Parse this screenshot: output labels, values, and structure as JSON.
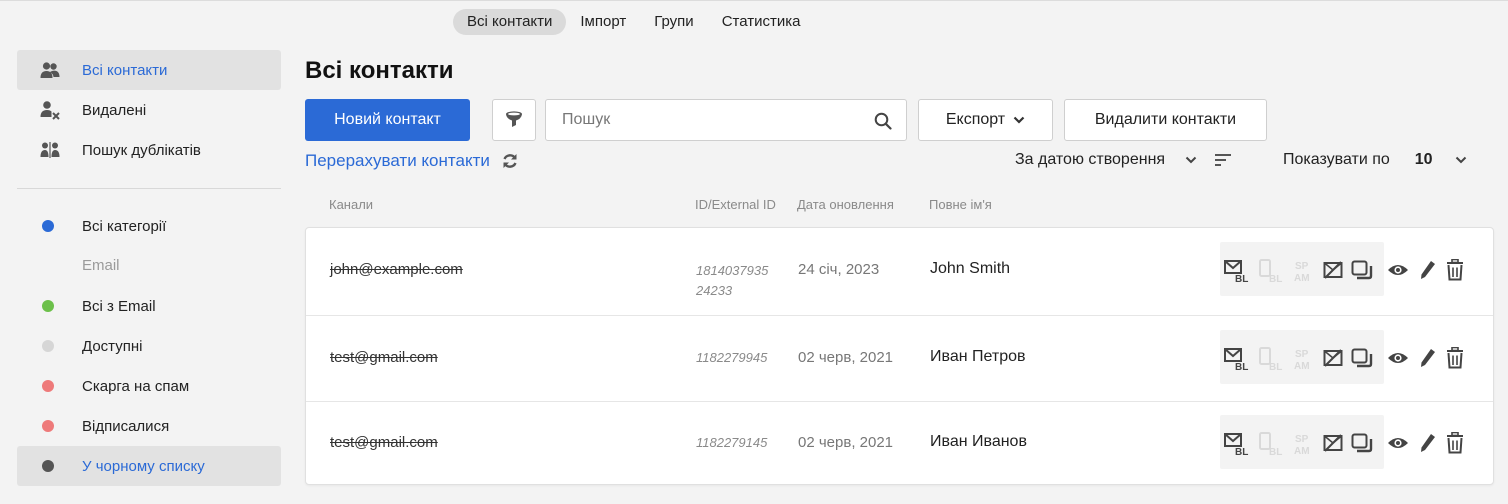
{
  "topnav": {
    "tabs": [
      {
        "label": "Всі контакти",
        "active": true
      },
      {
        "label": "Імпорт",
        "active": false
      },
      {
        "label": "Групи",
        "active": false
      },
      {
        "label": "Статистика",
        "active": false
      }
    ]
  },
  "sidebar": {
    "items": [
      {
        "label": "Всі контакти",
        "icon": "users-icon",
        "active": true
      },
      {
        "label": "Видалені",
        "icon": "user-remove-icon",
        "active": false
      },
      {
        "label": "Пошук дублікатів",
        "icon": "duplicates-icon",
        "active": false
      }
    ],
    "categories": [
      {
        "label": "Всі категорії",
        "color": "#2b6ad6"
      }
    ],
    "email_section": "Email",
    "email_items": [
      {
        "label": "Всі з Email",
        "color": "#6cc04a"
      },
      {
        "label": "Доступні",
        "color": "#d6d6d6"
      },
      {
        "label": "Скарга на спам",
        "color": "#ee7a7a"
      },
      {
        "label": "Відписалися",
        "color": "#ee7a7a"
      },
      {
        "label": "У чорному списку",
        "color": "#555555",
        "active": true
      }
    ]
  },
  "main": {
    "title": "Всі контакти",
    "new_contact_label": "Новий контакт",
    "search_placeholder": "Пошук",
    "export_label": "Експорт",
    "delete_label": "Видалити контакти",
    "recount_label": "Перерахувати контакти",
    "sort_label": "За датою створення",
    "per_page_label": "Показувати по",
    "per_page_value": "10"
  },
  "table": {
    "headers": {
      "channels": "Канали",
      "id": "ID/External ID",
      "date": "Дата оновлення",
      "name": "Повне ім'я"
    },
    "rows": [
      {
        "email": "john@example.com",
        "id_line1": "1814037935",
        "id_line2": "24233",
        "date": "24 січ, 2023",
        "name": "John Smith"
      },
      {
        "email": "test@gmail.com",
        "id_line1": "1182279945",
        "id_line2": "",
        "date": "02 черв, 2021",
        "name": "Иван Петров"
      },
      {
        "email": "test@gmail.com",
        "id_line1": "1182279145",
        "id_line2": "",
        "date": "02 черв, 2021",
        "name": "Иван Иванов"
      }
    ],
    "action_labels": {
      "bl": "BL",
      "spam_top": "SP",
      "spam_bottom": "AM"
    }
  },
  "colors": {
    "accent": "#2b6ad6",
    "text": "#222222",
    "muted": "#8a8a8a"
  }
}
